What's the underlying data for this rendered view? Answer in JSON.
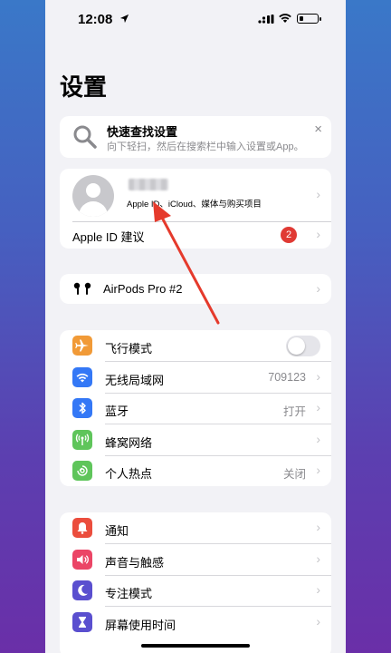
{
  "status_bar": {
    "time": "12:08"
  },
  "page": {
    "title": "设置"
  },
  "search": {
    "title": "快速查找设置",
    "subtitle": "向下轻扫，然后在搜索栏中输入设置或App。",
    "close": "×"
  },
  "profile": {
    "subtitle": "Apple ID、iCloud、媒体与购买项目",
    "suggestion_label": "Apple ID 建议",
    "suggestion_badge": "2"
  },
  "airpods": {
    "label": "AirPods Pro #2"
  },
  "network": {
    "items": [
      {
        "label": "飞行模式",
        "value": "",
        "icon": "airplane-icon",
        "color": "#f19a37",
        "toggle_on": false
      },
      {
        "label": "无线局域网",
        "value": "709123",
        "icon": "wifi-icon",
        "color": "#3478f6"
      },
      {
        "label": "蓝牙",
        "value": "打开",
        "icon": "bluetooth-icon",
        "color": "#3478f6"
      },
      {
        "label": "蜂窝网络",
        "value": "",
        "icon": "cellular-icon",
        "color": "#5fc55b"
      },
      {
        "label": "个人热点",
        "value": "关闭",
        "icon": "hotspot-icon",
        "color": "#5fc55b"
      }
    ]
  },
  "system": {
    "items": [
      {
        "label": "通知",
        "icon": "notification-icon",
        "color": "#eb4d3d"
      },
      {
        "label": "声音与触感",
        "icon": "sound-icon",
        "color": "#eb4566"
      },
      {
        "label": "专注模式",
        "icon": "moon-icon",
        "color": "#5a4fcf"
      },
      {
        "label": "屏幕使用时间",
        "icon": "hourglass-icon",
        "color": "#5a4fcf"
      }
    ]
  },
  "annotation_color": "#e53a2c"
}
